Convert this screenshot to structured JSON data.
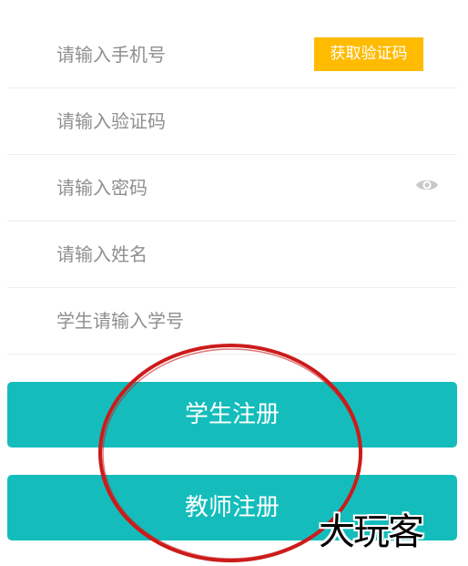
{
  "form": {
    "phone_placeholder": "请输入手机号",
    "get_code_label": "获取验证码",
    "code_placeholder": "请输入验证码",
    "password_placeholder": "请输入密码",
    "password_toggle_icon": "eye-icon",
    "name_placeholder": "请输入姓名",
    "student_id_placeholder": "学生请输入学号"
  },
  "actions": {
    "student_register_label": "学生注册",
    "teacher_register_label": "教师注册"
  },
  "watermark": {
    "text": "大玩客"
  },
  "colors": {
    "accent": "#14bdbb",
    "sms_button": "#ffbb00",
    "annotation_circle": "#cc1b1b",
    "placeholder": "#8f8f8f",
    "divider": "#ededed"
  }
}
